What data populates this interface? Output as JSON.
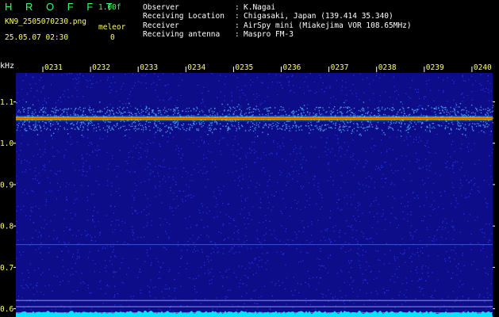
{
  "header": {
    "title": "H R O F F T",
    "version": "1.00f",
    "file_name": "KN9_2505070230.png",
    "meleor_label": "meleor",
    "meleor_count": "0",
    "timestamp": "25.05.07 02:30",
    "info": [
      {
        "label": "Observer",
        "value": "K.Nagai"
      },
      {
        "label": "Receiving Location",
        "value": "Chigasaki, Japan (139.414 35.340)"
      },
      {
        "label": "Receiver",
        "value": "AirSpy mini (Miakejima VOR 108.65MHz)"
      },
      {
        "label": "Receiving antenna",
        "value": "Maspro FM-3"
      }
    ]
  },
  "chart_data": {
    "type": "heatmap",
    "ylabel": "kHz",
    "y_ticks": [
      "1.1",
      "1.0",
      "0.9",
      "0.8",
      "0.7",
      "0.6"
    ],
    "y_tick_values": [
      1.1,
      1.0,
      0.9,
      0.8,
      0.7,
      0.6
    ],
    "ylim": [
      0.58,
      1.17
    ],
    "x_ticks": [
      "0231",
      "0232",
      "0233",
      "0234",
      "0235",
      "0236",
      "0237",
      "0238",
      "0239",
      "0240"
    ],
    "signal_line_khz": 1.06,
    "horizontal_lines_khz": [
      0.755,
      0.62,
      0.605,
      0.59
    ],
    "colors": {
      "background": "#0d0d8a",
      "noise_dot": "#2a3cff",
      "noise_bright": "#5cc8ff",
      "signal": "#ff3b1a",
      "signal_glow": "#ffd000",
      "signal_halo": "#00e0ff",
      "bottom_band": "#00e5ff",
      "tick_label": "#ffff66",
      "axis_label": "#ffffff"
    }
  }
}
